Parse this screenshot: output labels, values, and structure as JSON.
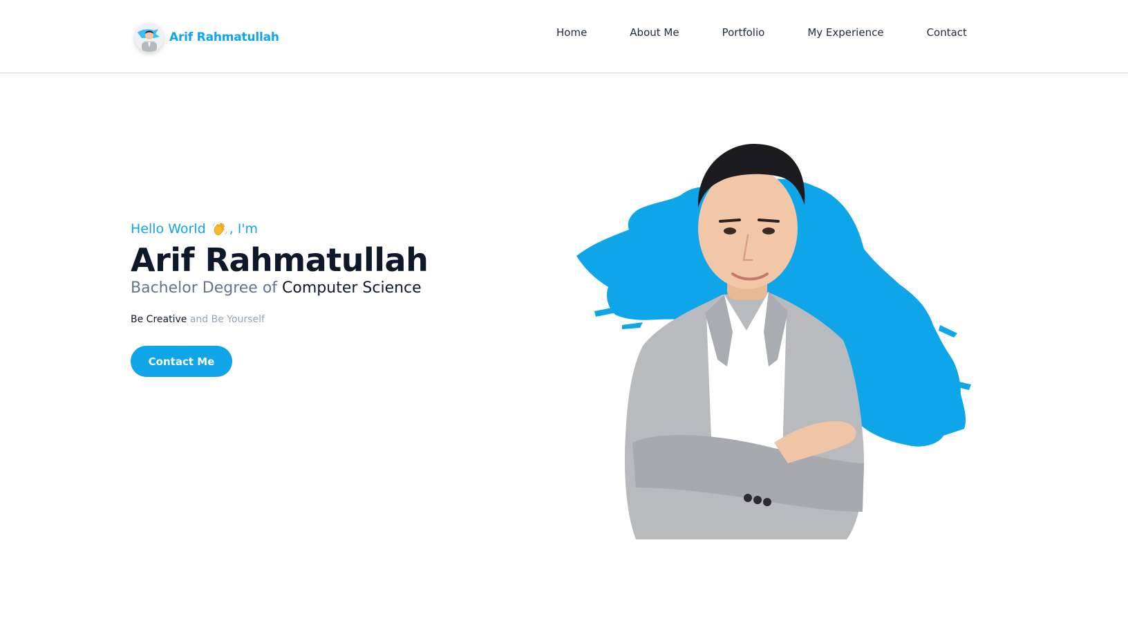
{
  "brand": {
    "name": "Arif Rahmatullah",
    "avatar_icon": "profile-avatar",
    "color": "#0ea5e9"
  },
  "nav": {
    "items": [
      {
        "label": "Home"
      },
      {
        "label": "About Me"
      },
      {
        "label": "Portfolio"
      },
      {
        "label": "My Experience"
      },
      {
        "label": "Contact"
      }
    ]
  },
  "hero": {
    "greeting_pre": "Hello World",
    "greeting_icon": "waving-hand-icon",
    "greeting_post": ", I'm",
    "name": "Arif Rahmatullah",
    "degree_muted": "Bachelor Degree of ",
    "degree_strong": "Computer Science",
    "tagline_strong": "Be Creative",
    "tagline_muted": " and Be Yourself",
    "cta_label": "Contact Me",
    "portrait_icon": "portrait-photo",
    "accent_color": "#0ea5e9"
  }
}
